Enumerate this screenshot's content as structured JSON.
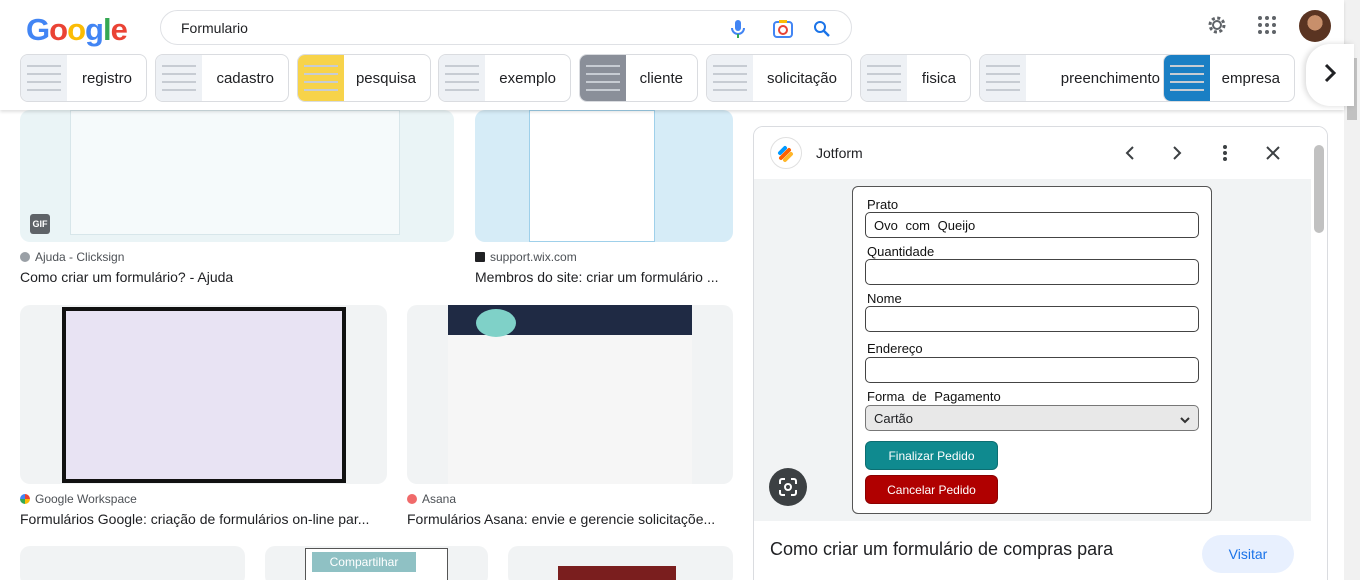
{
  "search": {
    "query": "Formulario"
  },
  "logo": [
    "G",
    "o",
    "o",
    "g",
    "l",
    "e"
  ],
  "logo_colors": [
    "#4285F4",
    "#EA4335",
    "#FBBC05",
    "#4285F4",
    "#34A853",
    "#EA4335"
  ],
  "icons": {
    "mic": "microphone-icon",
    "lens": "google-lens-icon",
    "search": "search-icon",
    "settings": "gear-icon",
    "apps": "apps-grid-icon",
    "chevron": "chevron-right-icon"
  },
  "chips": [
    "registro",
    "cadastro",
    "pesquisa",
    "exemplo",
    "cliente",
    "solicitação",
    "fisica",
    "preenchimento",
    "empresa"
  ],
  "results": [
    {
      "source": "Ajuda - Clicksign",
      "title": "Como criar um formulário? - Ajuda",
      "badge": "GIF"
    },
    {
      "source": "support.wix.com",
      "title": "Membros do site: criar um formulário ..."
    },
    {
      "source": "Google Workspace",
      "title": "Formulários Google: criação de formulários on-line par..."
    },
    {
      "source": "Asana",
      "title": "Formulários Asana: envie e gerencie solicitaçõe..."
    }
  ],
  "third_row": {
    "share_label": "Compartilhar"
  },
  "panel": {
    "site": "Jotform",
    "title": "Como criar um formulário de compras para",
    "visit": "Visitar",
    "form": {
      "fields": [
        {
          "label": "Prato",
          "value": "Ovo com Queijo"
        },
        {
          "label": "Quantidade",
          "value": ""
        },
        {
          "label": "Nome",
          "value": ""
        },
        {
          "label": "Endereço",
          "value": ""
        }
      ],
      "payment_label": "Forma de Pagamento",
      "payment_value": "Cartão",
      "submit": "Finalizar Pedido",
      "cancel": "Cancelar Pedido"
    }
  },
  "colors": {
    "submit": "#0f8a8f",
    "cancel": "#b00000",
    "link": "#1a73e8"
  }
}
